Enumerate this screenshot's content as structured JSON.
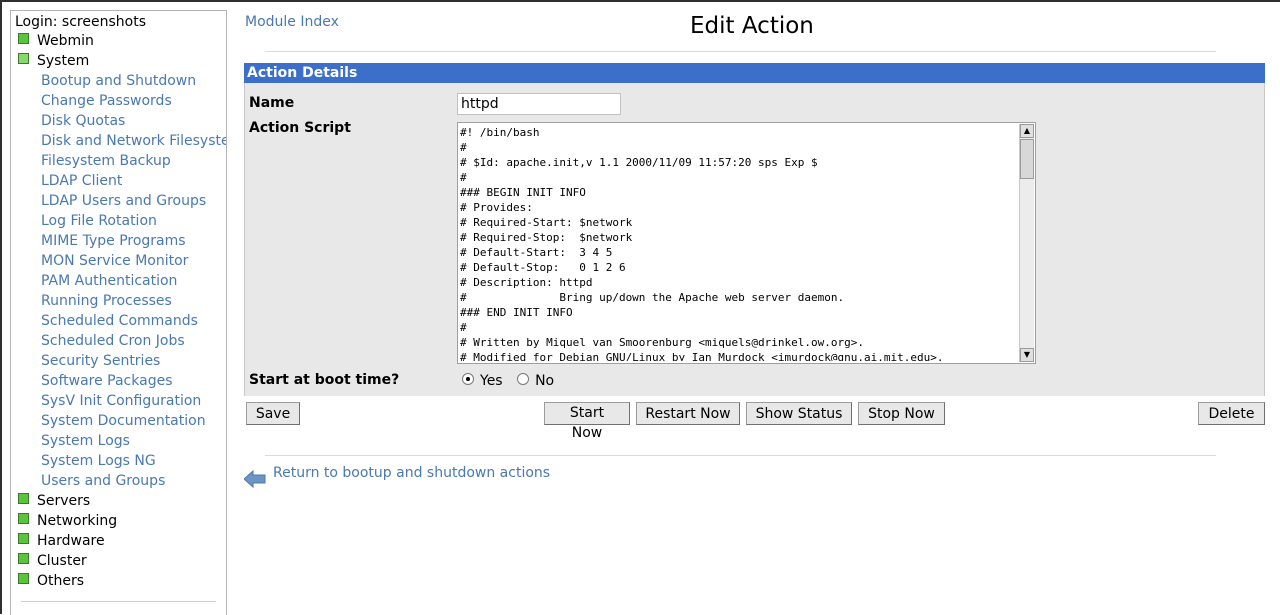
{
  "nav": {
    "login": "Login: screenshots",
    "categories": {
      "webmin": "Webmin",
      "system": "System",
      "servers": "Servers",
      "networking": "Networking",
      "hardware": "Hardware",
      "cluster": "Cluster",
      "others": "Others"
    },
    "system_items": [
      "Bootup and Shutdown",
      "Change Passwords",
      "Disk Quotas",
      "Disk and Network Filesystems",
      "Filesystem Backup",
      "LDAP Client",
      "LDAP Users and Groups",
      "Log File Rotation",
      "MIME Type Programs",
      "MON Service Monitor",
      "PAM Authentication",
      "Running Processes",
      "Scheduled Commands",
      "Scheduled Cron Jobs",
      "Security Sentries",
      "Software Packages",
      "SysV Init Configuration",
      "System Documentation",
      "System Logs",
      "System Logs NG",
      "Users and Groups"
    ]
  },
  "header": {
    "module_index": "Module Index",
    "title": "Edit Action"
  },
  "form": {
    "section_title": "Action Details",
    "name_label": "Name",
    "name_value": "httpd",
    "script_label": "Action Script",
    "script_lines": [
      "#! /bin/bash",
      "#",
      "# $Id: apache.init,v 1.1 2000/11/09 11:57:20 sps Exp $",
      "#",
      "### BEGIN INIT INFO",
      "# Provides:",
      "# Required-Start: $network",
      "# Required-Stop:  $network",
      "# Default-Start:  3 4 5",
      "# Default-Stop:   0 1 2 6",
      "# Description: httpd",
      "#              Bring up/down the Apache web server daemon.",
      "### END INIT INFO",
      "#",
      "# Written by Miquel van Smoorenburg <miquels@drinkel.ow.org>.",
      "# Modified for Debian GNU/Linux by Ian Murdock <imurdock@gnu.ai.mit.edu>."
    ],
    "boot_label": "Start at boot time?",
    "boot_yes": "Yes",
    "boot_no": "No",
    "boot_selected": "Yes"
  },
  "buttons": {
    "save": "Save",
    "start_now": "Start Now",
    "restart_now": "Restart Now",
    "show_status": "Show Status",
    "stop_now": "Stop Now",
    "delete": "Delete"
  },
  "footer": {
    "return_link": "Return to bootup and shutdown actions"
  },
  "colors": {
    "link": "#4a78b0",
    "section_header": "#3b6fc9",
    "panel": "#e8e8e8"
  }
}
